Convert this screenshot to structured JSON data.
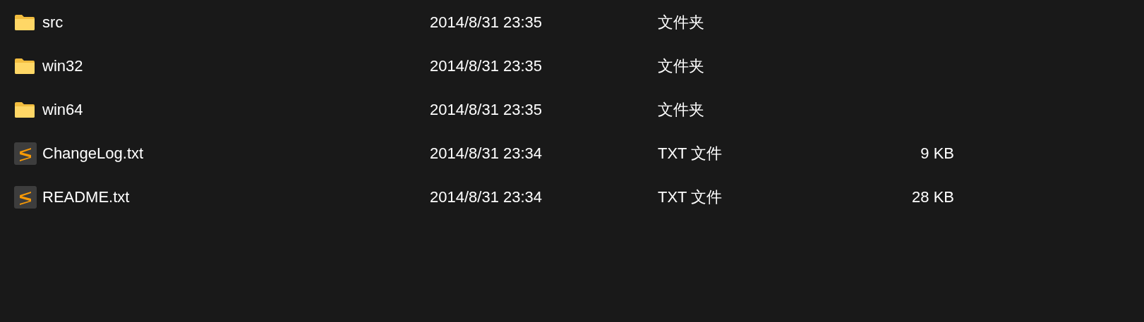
{
  "files": [
    {
      "kind": "folder",
      "name": "src",
      "modified": "2014/8/31 23:35",
      "type": "文件夹"
    },
    {
      "kind": "folder",
      "name": "win32",
      "modified": "2014/8/31 23:35",
      "type": "文件夹"
    },
    {
      "kind": "folder",
      "name": "win64",
      "modified": "2014/8/31 23:35",
      "type": "文件夹"
    },
    {
      "kind": "text",
      "name": "ChangeLog.txt",
      "modified": "2014/8/31 23:34",
      "type": "TXT 文件",
      "size": "9 KB"
    },
    {
      "kind": "text",
      "name": "README.txt",
      "modified": "2014/8/31 23:34",
      "type": "TXT 文件",
      "size": "28 KB"
    }
  ]
}
